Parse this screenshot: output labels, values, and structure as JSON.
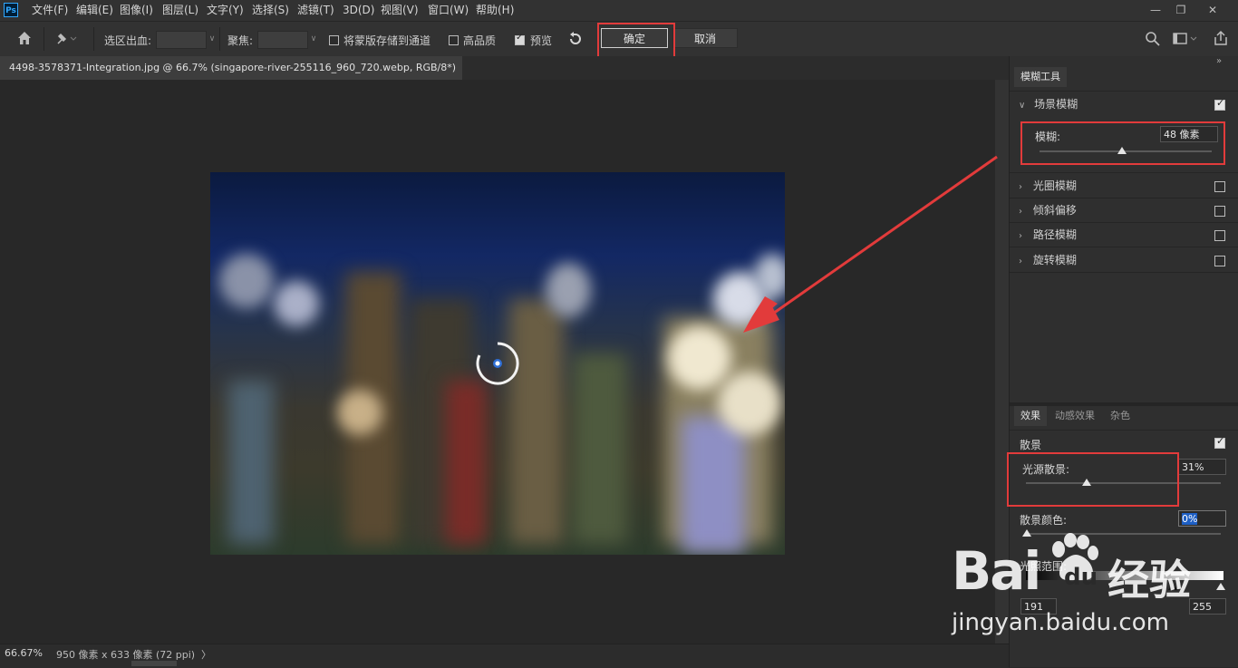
{
  "app": {
    "logo": "Ps"
  },
  "menu": [
    "文件(F)",
    "编辑(E)",
    "图像(I)",
    "图层(L)",
    "文字(Y)",
    "选择(S)",
    "滤镜(T)",
    "3D(D)",
    "视图(V)",
    "窗口(W)",
    "帮助(H)"
  ],
  "window_controls": {
    "minimize": "—",
    "restore": "❐",
    "close": "✕"
  },
  "options": {
    "bleed_label": "选区出血:",
    "focus_label": "聚焦:",
    "save_mask_label": "将蒙版存储到通道",
    "save_mask_checked": false,
    "high_quality_label": "高品质",
    "high_quality_checked": false,
    "preview_label": "预览",
    "preview_checked": true,
    "ok_label": "确定",
    "cancel_label": "取消"
  },
  "document": {
    "tab_title": "4498-3578371-Integration.jpg @ 66.7% (singapore-river-255116_960_720.webp, RGB/8*) *",
    "tab_close": "×"
  },
  "status": {
    "zoom": "66.67%",
    "doc_info": "950 像素 x 633 像素 (72 ppi)",
    "arrow": "〉"
  },
  "blur_tools": {
    "tab_label": "模糊工具",
    "sections": [
      {
        "label": "场景模糊",
        "checked": true,
        "expanded": true
      },
      {
        "label": "光圈模糊",
        "checked": false
      },
      {
        "label": "倾斜偏移",
        "checked": false
      },
      {
        "label": "路径模糊",
        "checked": false
      },
      {
        "label": "旋转模糊",
        "checked": false
      }
    ],
    "blur_label": "模糊:",
    "blur_value": "48 像素",
    "blur_level": 0.48
  },
  "effects": {
    "tabs": [
      "效果",
      "动感效果",
      "杂色"
    ],
    "bokeh_label": "散景",
    "bokeh_checked": true,
    "light_bokeh_label": "光源散景:",
    "light_bokeh_value": "31%",
    "light_bokeh_level": 0.31,
    "bokeh_color_label": "散景颜色:",
    "bokeh_color_value": "0%",
    "light_range_label": "光照范围:",
    "light_range_low": "191",
    "light_range_high": "255"
  },
  "watermark": {
    "brand": "Bai",
    "brand2": "du",
    "cn": "经验",
    "url": "jingyan.baidu.com"
  },
  "colors": {
    "accent": "#e23b3b",
    "panel": "#2f2f2f",
    "selection": "#1e5fc4"
  }
}
